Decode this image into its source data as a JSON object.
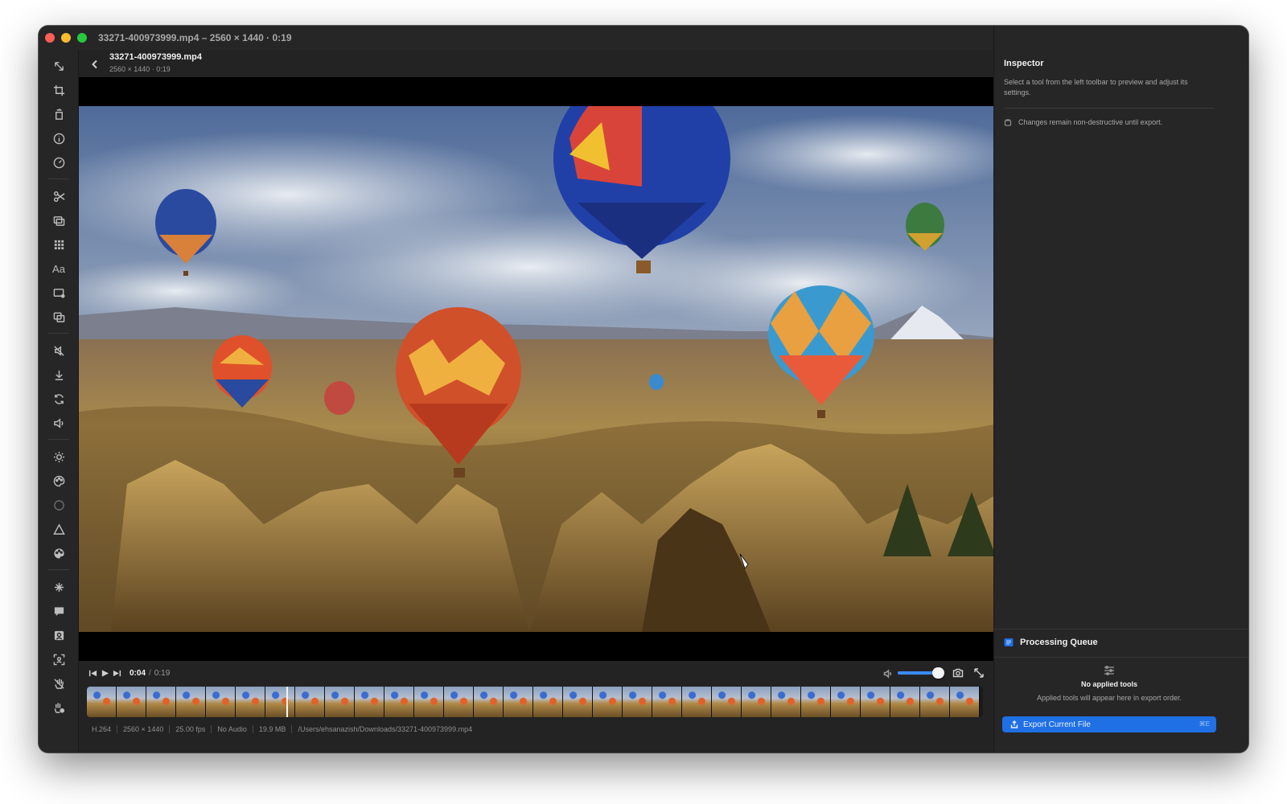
{
  "window": {
    "title": "33271-400973999.mp4 – 2560 × 1440 · 0:19"
  },
  "file_header": {
    "name": "33271-400973999.mp4",
    "meta": "2560 × 1440 · 0:19"
  },
  "toolbar": {
    "tools": [
      {
        "name": "resize-tool",
        "icon": "arrows-diagonal-icon"
      },
      {
        "name": "crop-tool",
        "icon": "crop-icon"
      },
      {
        "name": "rotate-tool",
        "icon": "rotate-square-icon"
      },
      {
        "name": "info-tool",
        "icon": "info-icon"
      },
      {
        "name": "speed-tool",
        "icon": "gauge-icon"
      },
      {
        "name": "trim-tool",
        "icon": "scissors-icon"
      },
      {
        "name": "layers-tool",
        "icon": "layers-icon"
      },
      {
        "name": "grid-tool",
        "icon": "grid-icon"
      },
      {
        "name": "text-tool",
        "icon": "text-aa-icon",
        "label": "Aa"
      },
      {
        "name": "overlay-tool",
        "icon": "overlay-icon"
      },
      {
        "name": "duplicate-tool",
        "icon": "duplicate-icon"
      },
      {
        "name": "mute-tool",
        "icon": "mute-icon"
      },
      {
        "name": "download-tool",
        "icon": "download-icon"
      },
      {
        "name": "loop-tool",
        "icon": "loop-icon"
      },
      {
        "name": "volume-tool",
        "icon": "volume-icon"
      },
      {
        "name": "brightness-tool",
        "icon": "sun-icon"
      },
      {
        "name": "color-tool",
        "icon": "palette-icon"
      },
      {
        "name": "vignette-tool",
        "icon": "circle-icon"
      },
      {
        "name": "sharpen-tool",
        "icon": "triangle-icon"
      },
      {
        "name": "filter-tool",
        "icon": "palette-filled-icon"
      },
      {
        "name": "denoise-tool",
        "icon": "sparkle-off-icon"
      },
      {
        "name": "subtitle-tool",
        "icon": "speech-bubble-icon"
      },
      {
        "name": "portrait-tool",
        "icon": "person-card-icon"
      },
      {
        "name": "face-tool",
        "icon": "face-frame-icon"
      },
      {
        "name": "stabilize-tool",
        "icon": "hand-icon"
      },
      {
        "name": "gesture-tool",
        "icon": "hand-settings-icon"
      }
    ]
  },
  "player": {
    "current_time": "0:04",
    "separator": "/",
    "total_time": "0:19",
    "volume_level": 0.86,
    "playhead_fraction": 0.223,
    "thumb_count": 30
  },
  "statusbar": {
    "items": [
      "H.264",
      "2560 × 1440",
      "25.00 fps",
      "No Audio",
      "19.9 MB",
      "/Users/ehsanazish/Downloads/33271-400973999.mp4"
    ]
  },
  "inspector": {
    "title": "Inspector",
    "description": "Select a tool from the left toolbar to preview and adjust its settings.",
    "note": "Changes remain non-destructive until export."
  },
  "queue": {
    "title": "Processing Queue",
    "empty_title": "No applied tools",
    "empty_subtitle": "Applied tools will appear here in export order.",
    "export_label": "Export Current File",
    "export_shortcut": "⌘E"
  },
  "colors": {
    "accent": "#1f6fe5",
    "window_bg": "#232323",
    "panel_bg": "#262626"
  }
}
